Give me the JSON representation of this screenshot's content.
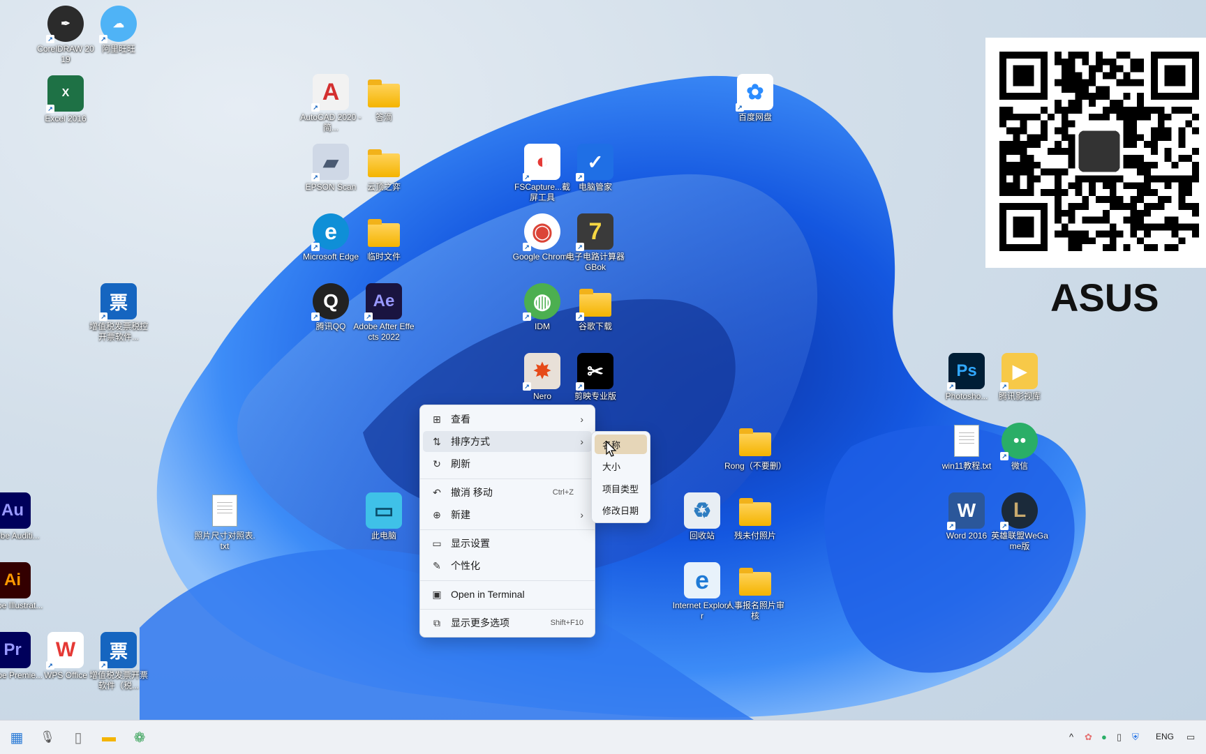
{
  "desktop": {
    "icons": [
      {
        "label": "CorelDRAW 2019",
        "glyph": "✒",
        "bg": "#2b2b2b",
        "fg": "#ffffff"
      },
      {
        "label": "阿里旺旺",
        "glyph": "☁",
        "bg": "#4fb3f6",
        "fg": "#ffffff"
      },
      {
        "label": "Excel 2016",
        "glyph": "X",
        "bg": "#1e7145",
        "fg": "#ffffff"
      },
      {
        "label": "AutoCAD 2020 - 简...",
        "glyph": "A",
        "bg": "#f2f2f2",
        "fg": "#d32f2f"
      },
      {
        "label": "答滴",
        "glyph": "",
        "bg": "folder",
        "fg": ""
      },
      {
        "label": "百度网盘",
        "glyph": "✿",
        "bg": "#ffffff",
        "fg": "#2b8cff"
      },
      {
        "label": "EPSON Scan",
        "glyph": "▰",
        "bg": "#cfd8e6",
        "fg": "#4a5a72"
      },
      {
        "label": "云顶之弈",
        "glyph": "",
        "bg": "folder",
        "fg": ""
      },
      {
        "label": "FSCapture...截屏工具",
        "glyph": "◐",
        "bg": "#ffffff",
        "fg": "#e53935"
      },
      {
        "label": "电脑管家",
        "glyph": "✓",
        "bg": "#1f6fe5",
        "fg": "#ffffff"
      },
      {
        "label": "Microsoft Edge",
        "glyph": "e",
        "bg": "#0f8fd7",
        "fg": "#ffffff"
      },
      {
        "label": "临时文件",
        "glyph": "",
        "bg": "folder",
        "fg": ""
      },
      {
        "label": "Google Chrome",
        "glyph": "◉",
        "bg": "#ffffff",
        "fg": "#db4437"
      },
      {
        "label": "电子电路计算器GBok",
        "glyph": "7",
        "bg": "#3a3a3a",
        "fg": "#f6d743"
      },
      {
        "label": "增值税发票税控开票软件...",
        "glyph": "票",
        "bg": "#1565c0",
        "fg": "#ffffff"
      },
      {
        "label": "腾讯QQ",
        "glyph": "Q",
        "bg": "#222222",
        "fg": "#ffffff"
      },
      {
        "label": "Adobe After Effects 2022",
        "glyph": "Ae",
        "bg": "#1a1440",
        "fg": "#9999ff"
      },
      {
        "label": "IDM",
        "glyph": "◍",
        "bg": "#4caf50",
        "fg": "#ffffff"
      },
      {
        "label": "谷歌下载",
        "glyph": "",
        "bg": "folder",
        "fg": ""
      },
      {
        "label": "Nero",
        "glyph": "✸",
        "bg": "#e8e0d8",
        "fg": "#e64a19"
      },
      {
        "label": "剪映专业版",
        "glyph": "✂",
        "bg": "#000000",
        "fg": "#ffffff"
      },
      {
        "label": "Photosho...",
        "glyph": "Ps",
        "bg": "#001e36",
        "fg": "#31a8ff"
      },
      {
        "label": "腾讯影视库",
        "glyph": "▶",
        "bg": "#f7c948",
        "fg": "#ffffff"
      },
      {
        "label": "Rong（不要删）",
        "glyph": "",
        "bg": "folder",
        "fg": ""
      },
      {
        "label": "win11教程.txt",
        "glyph": "",
        "bg": "doc",
        "fg": ""
      },
      {
        "label": "微信",
        "glyph": "●●",
        "bg": "#2aae67",
        "fg": "#ffffff"
      },
      {
        "label": "Adobe Auditi...",
        "glyph": "Au",
        "bg": "#00005b",
        "fg": "#9999ff"
      },
      {
        "label": "照片尺寸对照表.txt",
        "glyph": "",
        "bg": "doc",
        "fg": ""
      },
      {
        "label": "此电脑",
        "glyph": "▭",
        "bg": "#3fc1e8",
        "fg": "#0b4f6c"
      },
      {
        "label": "回收站",
        "glyph": "♻",
        "bg": "#e8eef4",
        "fg": "#2e7dc1"
      },
      {
        "label": "残未付照片",
        "glyph": "",
        "bg": "folder",
        "fg": ""
      },
      {
        "label": "Word 2016",
        "glyph": "W",
        "bg": "#2b579a",
        "fg": "#ffffff"
      },
      {
        "label": "英雄联盟WeGame版",
        "glyph": "L",
        "bg": "#1b2a3a",
        "fg": "#c8aa6e"
      },
      {
        "label": "Adobe Illustrat...",
        "glyph": "Ai",
        "bg": "#330000",
        "fg": "#ff9a00"
      },
      {
        "label": "Internet Explorer",
        "glyph": "e",
        "bg": "#e8f2fb",
        "fg": "#1f7ad6"
      },
      {
        "label": "人事报名照片审核",
        "glyph": "",
        "bg": "folder",
        "fg": ""
      },
      {
        "label": "Adobe Premie...",
        "glyph": "Pr",
        "bg": "#00005b",
        "fg": "#9999ff"
      },
      {
        "label": "WPS Office",
        "glyph": "W",
        "bg": "#ffffff",
        "fg": "#e53935"
      },
      {
        "label": "增值税发票开票软件（税...",
        "glyph": "票",
        "bg": "#1565c0",
        "fg": "#ffffff"
      }
    ],
    "qr_brand": "ASUS"
  },
  "context_menu": {
    "items": [
      {
        "label": "查看",
        "icon": "grid-icon",
        "glyph": "⊞",
        "shortcut": "",
        "submenu": true
      },
      {
        "label": "排序方式",
        "icon": "sort-icon",
        "glyph": "⇅",
        "shortcut": "",
        "submenu": true
      },
      {
        "label": "刷新",
        "icon": "refresh-icon",
        "glyph": "↻",
        "shortcut": "",
        "submenu": false
      },
      {
        "label": "撤消 移动",
        "icon": "undo-icon",
        "glyph": "↶",
        "shortcut": "Ctrl+Z",
        "submenu": false
      },
      {
        "label": "新建",
        "icon": "new-icon",
        "glyph": "⊕",
        "shortcut": "",
        "submenu": true
      },
      {
        "label": "显示设置",
        "icon": "display-icon",
        "glyph": "▭",
        "shortcut": "",
        "submenu": false
      },
      {
        "label": "个性化",
        "icon": "brush-icon",
        "glyph": "✎",
        "shortcut": "",
        "submenu": false
      },
      {
        "label": "Open in Terminal",
        "icon": "terminal-icon",
        "glyph": "▣",
        "shortcut": "",
        "submenu": false
      },
      {
        "label": "显示更多选项",
        "icon": "more-options-icon",
        "glyph": "⧉",
        "shortcut": "Shift+F10",
        "submenu": false
      }
    ],
    "chevron": "›"
  },
  "sort_submenu": {
    "items": [
      "名称",
      "大小",
      "项目类型",
      "修改日期"
    ],
    "selected": "名称"
  },
  "taskbar": {
    "apps": [
      {
        "name": "calculator-icon",
        "glyph": "▦",
        "color": "#2b7bd6"
      },
      {
        "name": "microphone-icon",
        "glyph": "🎙",
        "color": "#555555"
      },
      {
        "name": "notepad-icon",
        "glyph": "▯",
        "color": "#777777"
      },
      {
        "name": "file-explorer-icon",
        "glyph": "▬",
        "color": "#f4b400"
      },
      {
        "name": "sync-icon",
        "glyph": "❁",
        "color": "#3aa35a"
      }
    ],
    "tray": {
      "chevron": "^",
      "language": "ENG"
    }
  },
  "colors": {
    "accent": "#1565c0",
    "menu_bg": "#f4f7fb",
    "submenu_highlight": "#e6d6b8"
  }
}
